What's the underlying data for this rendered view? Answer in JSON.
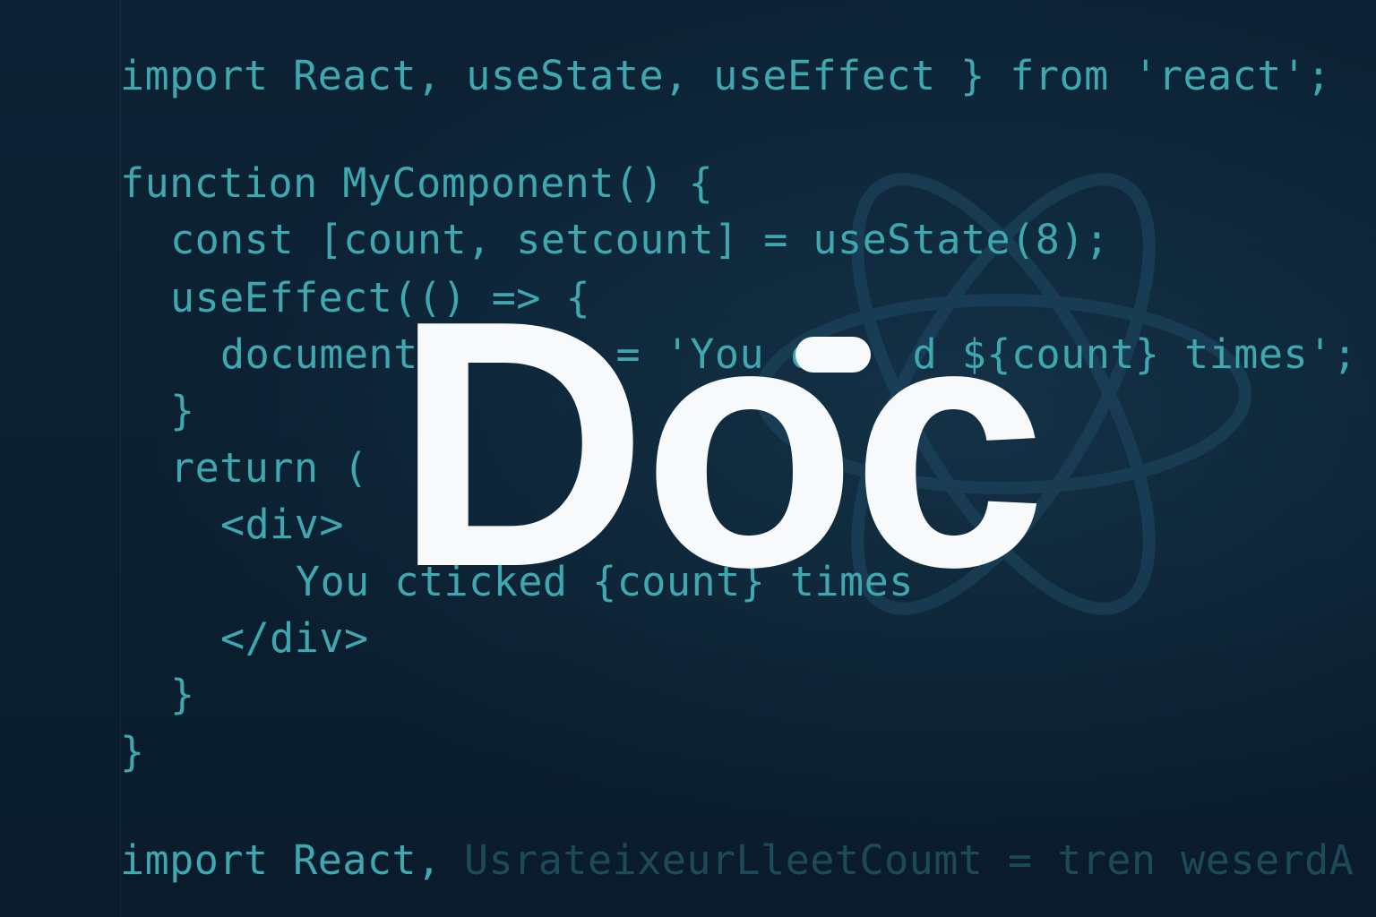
{
  "code": {
    "line1": "import React, useState, useEffect } from 'react';",
    "line2": "function MyComponent() {",
    "line3": "const [count, setcount] = useState(8);",
    "line4": "useEffect(() => {",
    "line5": "document        = 'You c    d ${count} times';",
    "line6": "}",
    "line7": "return (",
    "line8": "<div>",
    "line9": "You cticked {count} times",
    "line10": "</div>",
    "line11": "}",
    "line12": "}",
    "line13": "import React,",
    "line13_blurred": "UsrateixeurLleetCoumt = tren weserdA"
  },
  "title": {
    "text": "Doc"
  },
  "background": {
    "icon": "react-atom-icon"
  },
  "colors": {
    "background": "#0b1f31",
    "code": "#3fa7b0",
    "title": "#f7f9fb",
    "logo": "#1f4a63"
  }
}
